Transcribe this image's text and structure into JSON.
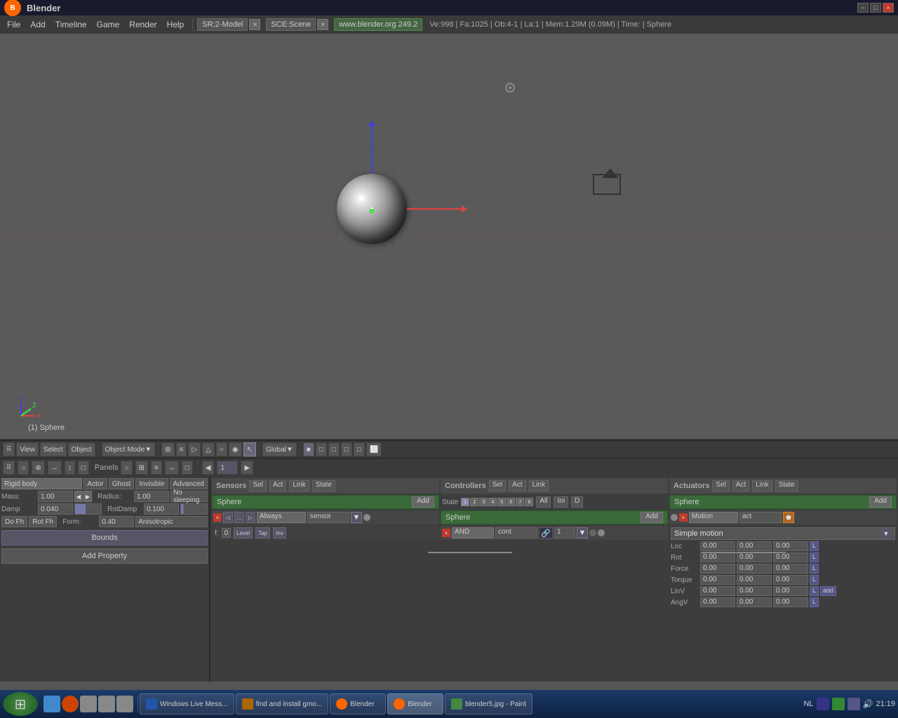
{
  "titlebar": {
    "title": "Blender",
    "minimize": "−",
    "maximize": "□",
    "close": "×"
  },
  "menubar": {
    "items": [
      "File",
      "Add",
      "Timeline",
      "Game",
      "Render",
      "Help"
    ],
    "scene1": "SR:2-Model",
    "scene2": "SCE:Scene",
    "url": "www.blender.org 249.2",
    "info": "Ve:998 | Fa:1025 | Ob:4-1 | La:1 | Mem:1.29M (0.09M) | Time: | Sphere"
  },
  "viewport": {
    "object_label": "(1) Sphere"
  },
  "toolbar": {
    "view": "View",
    "select": "Select",
    "object": "Object",
    "mode": "Object Mode",
    "global": "Global",
    "panels_label": "Panels"
  },
  "physics": {
    "type": "Rigid body",
    "actor_label": "Actor",
    "ghost_label": "Ghost",
    "invisible_label": "Invisible",
    "advanced_label": "Advanced",
    "mass_label": "Mass:",
    "mass_value": "1.00",
    "radius_label": "Radius:",
    "radius_value": "1.00",
    "sleeping_label": "No sleeping",
    "damp_label": "Damp",
    "damp_value": "0.040",
    "rotdamp_label": "RotDamp",
    "rotdamp_value": "0.100",
    "do_fh": "Do Fh",
    "rot_fh": "Rot Fh",
    "form_label": "Form:",
    "form_value": "0.40",
    "aniso_label": "Anisotropic",
    "bounds_label": "Bounds",
    "add_property_label": "Add Property"
  },
  "sensors": {
    "panel_label": "Sensors",
    "sel_label": "Sel",
    "act_label": "Act",
    "link_label": "Link",
    "state_label": "State",
    "sphere_label": "Sphere",
    "add_label": "Add",
    "type": "Always",
    "name": "sensor",
    "f_label": "f:",
    "f_value": "0",
    "level_label": "Level",
    "tap_label": "Tap",
    "inv_label": "Inv"
  },
  "controllers": {
    "panel_label": "Controllers",
    "sel_label": "Sel",
    "act_label": "Act",
    "link_label": "Link",
    "sphere_label": "Sphere",
    "add_label": "Add",
    "state_label": "State",
    "state_bits": [
      1,
      1,
      1,
      1,
      1,
      1,
      1,
      1,
      1,
      1,
      1,
      1,
      1,
      1,
      1,
      1,
      1,
      1,
      1,
      1,
      1,
      1,
      1,
      1,
      1,
      1,
      1,
      1,
      1,
      1
    ],
    "all_label": "All",
    "ini_label": "Ini",
    "d_label": "D",
    "and_label": "AND",
    "cont_name": "cont",
    "num_value": "1"
  },
  "actuators": {
    "panel_label": "Actuators",
    "sel_label": "Sel",
    "act_label": "Act",
    "link_label": "Link",
    "state_label": "State",
    "sphere_label": "Sphere",
    "add_label": "Add",
    "motion_label": "Motion",
    "act_name": "act",
    "simple_motion": "Simple motion",
    "loc_label": "Loc",
    "rot_label": "Rot",
    "force_label": "Force",
    "torque_label": "Torque",
    "linv_label": "LinV",
    "angv_label": "AngV",
    "val0": "0.00",
    "l_label": "L",
    "add_l_label": "add"
  },
  "taskbar": {
    "items": [
      {
        "label": "Windows Live Mess...",
        "icon": "messenger-icon"
      },
      {
        "label": "find and install gmo...",
        "icon": "search-icon"
      },
      {
        "label": "Blender",
        "icon": "blender-icon"
      },
      {
        "label": "Blender",
        "icon": "blender-icon2"
      },
      {
        "label": "blender5.jpg - Paint",
        "icon": "paint-icon"
      }
    ],
    "time": "21:19",
    "lang": "NL"
  }
}
